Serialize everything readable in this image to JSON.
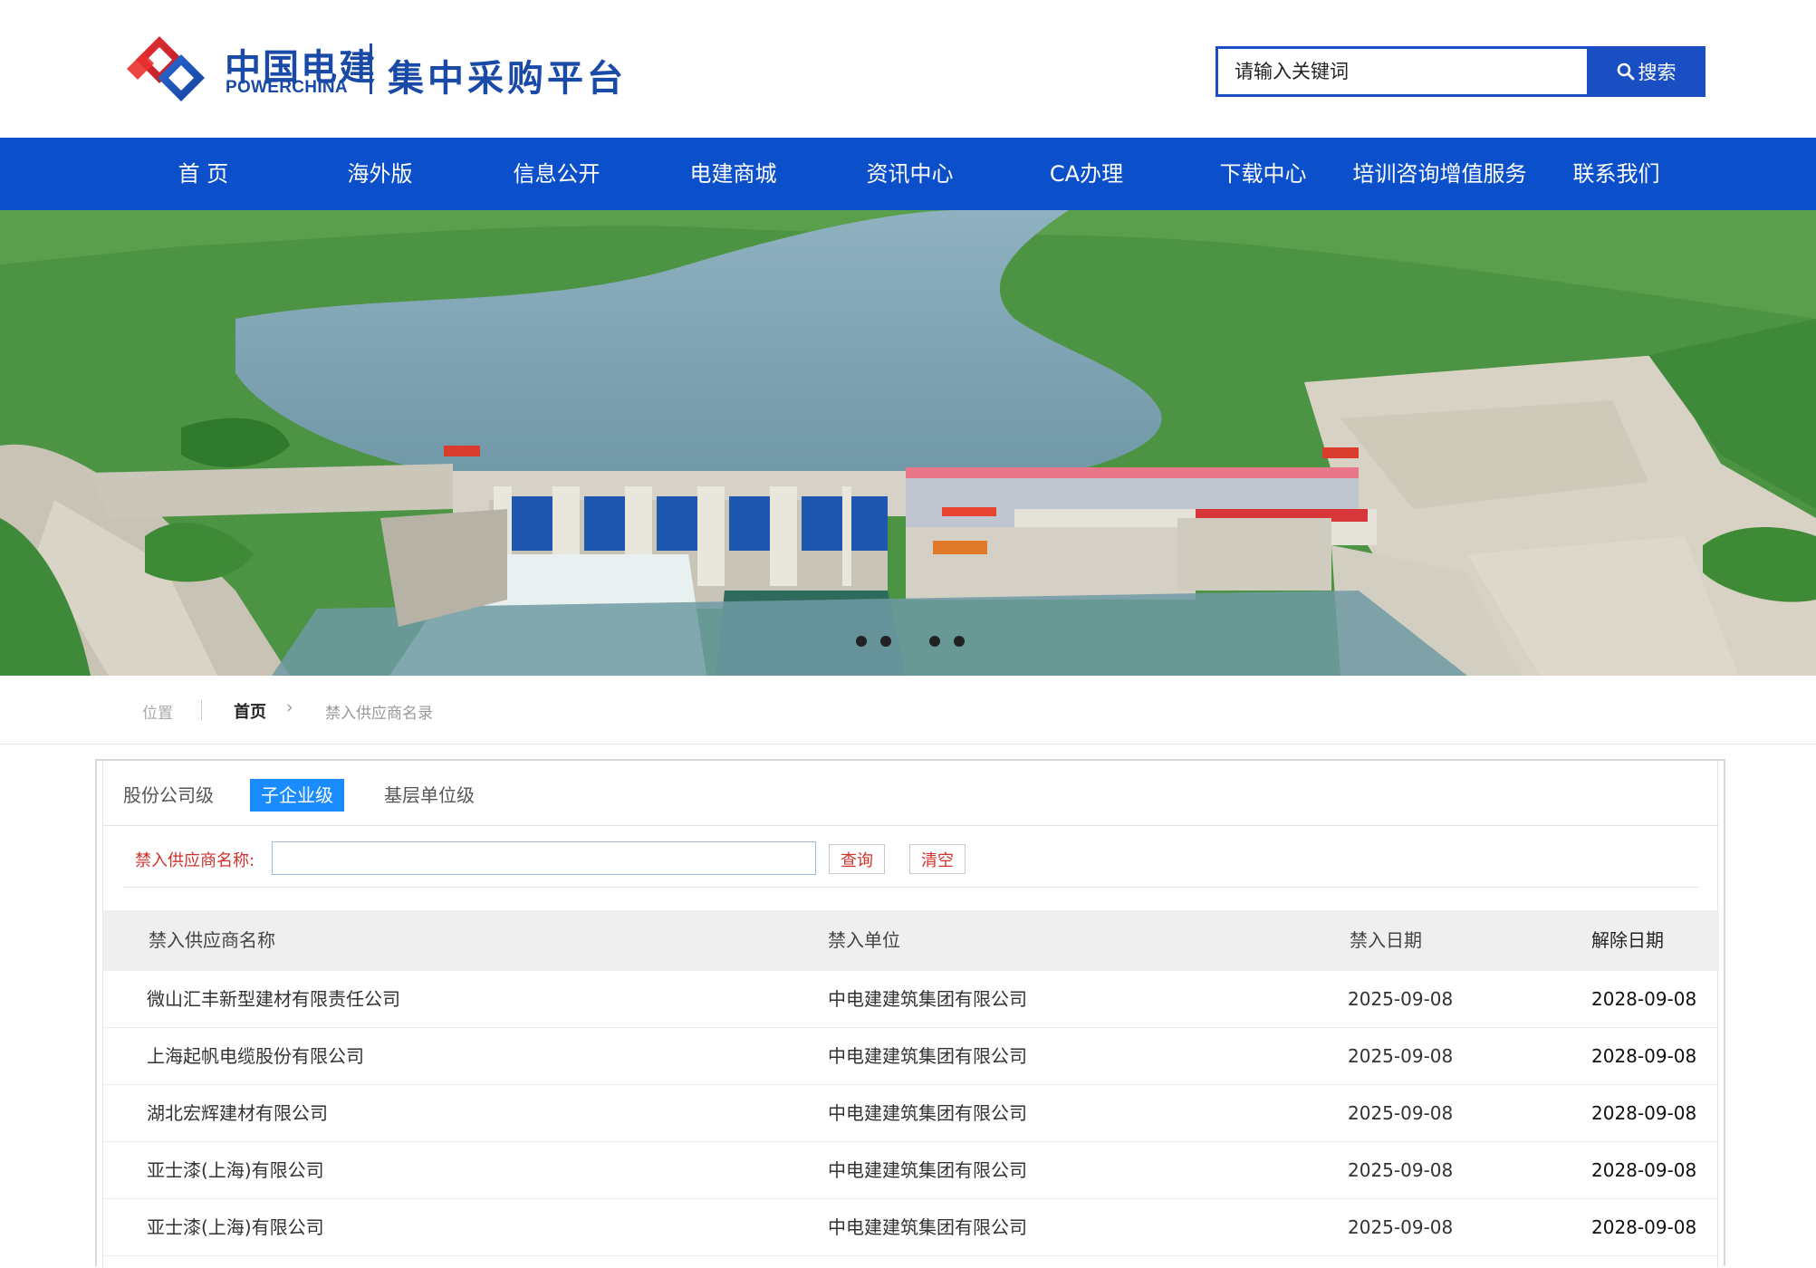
{
  "header": {
    "logo_cn": "中国电建",
    "logo_en": "POWERCHINA",
    "platform_title": "集中采购平台",
    "search_placeholder": "请输入关键词",
    "search_button": "搜索",
    "brand_color": "#1a4fc4"
  },
  "nav": {
    "items": [
      "首 页",
      "海外版",
      "信息公开",
      "电建商城",
      "资讯中心",
      "CA办理",
      "下载中心",
      "培训咨询增值服务",
      "联系我们"
    ],
    "bg_color": "#0b4fca"
  },
  "banner": {
    "slide_count": 4,
    "active_slide": 1
  },
  "breadcrumb": {
    "position_label": "位置",
    "home": "首页",
    "separator": "›",
    "current": "禁入供应商名录"
  },
  "tabs": {
    "items": [
      "股份公司级",
      "子企业级",
      "基层单位级"
    ],
    "active_index": 1,
    "active_color": "#1a8cff"
  },
  "filter": {
    "label": "禁入供应商名称:",
    "input_value": "",
    "query_button": "查询",
    "clear_button": "清空"
  },
  "table": {
    "columns": [
      "禁入供应商名称",
      "禁入单位",
      "禁入日期",
      "解除日期"
    ],
    "rows": [
      [
        "微山汇丰新型建材有限责任公司",
        "中电建建筑集团有限公司",
        "2025-09-08",
        "2028-09-08"
      ],
      [
        "上海起帆电缆股份有限公司",
        "中电建建筑集团有限公司",
        "2025-09-08",
        "2028-09-08"
      ],
      [
        "湖北宏辉建材有限公司",
        "中电建建筑集团有限公司",
        "2025-09-08",
        "2028-09-08"
      ],
      [
        "亚士漆(上海)有限公司",
        "中电建建筑集团有限公司",
        "2025-09-08",
        "2028-09-08"
      ],
      [
        "亚士漆(上海)有限公司",
        "中电建建筑集团有限公司",
        "2025-09-08",
        "2028-09-08"
      ]
    ]
  }
}
